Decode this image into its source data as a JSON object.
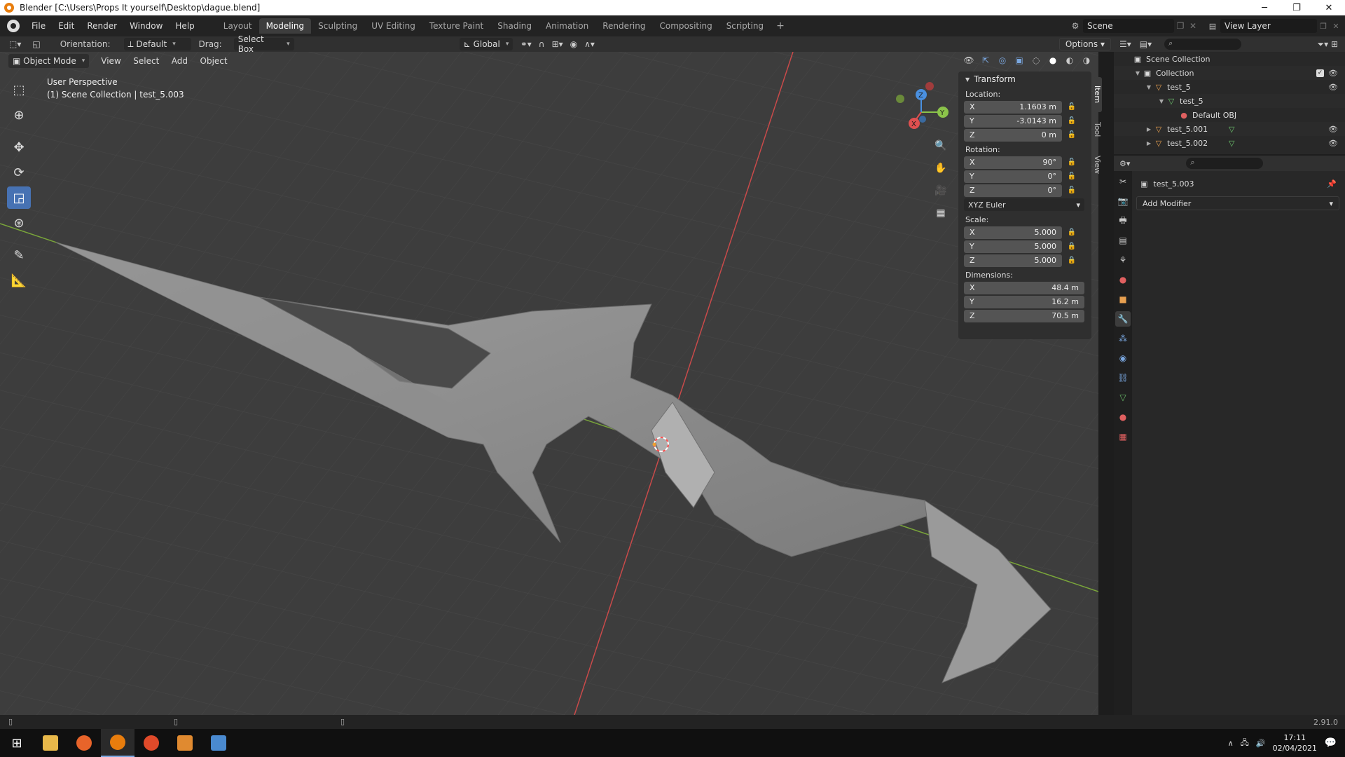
{
  "window": {
    "title": "Blender [C:\\Users\\Props It yourself\\Desktop\\dague.blend]",
    "controls": [
      "─",
      "❐",
      "✕"
    ]
  },
  "topmenu": {
    "items": [
      "File",
      "Edit",
      "Render",
      "Window",
      "Help"
    ],
    "workspaces": [
      "Layout",
      "Modeling",
      "Sculpting",
      "UV Editing",
      "Texture Paint",
      "Shading",
      "Animation",
      "Rendering",
      "Compositing",
      "Scripting"
    ],
    "active_workspace": "Modeling",
    "plus": "+",
    "scene": "Scene",
    "view_layer": "View Layer"
  },
  "toolheader": {
    "orientation_label": "Orientation:",
    "orientation_value": "Default",
    "drag_label": "Drag:",
    "drag_value": "Select Box",
    "transform_orientation": "Global",
    "options": "Options"
  },
  "viewport_header": {
    "mode": "Object Mode",
    "menus": [
      "View",
      "Select",
      "Add",
      "Object"
    ]
  },
  "viewport": {
    "perspective": "User Perspective",
    "collection_info": "(1) Scene Collection | test_5.003"
  },
  "gizmo": {
    "x": "X",
    "y": "Y",
    "z": "Z"
  },
  "npanel": {
    "title": "Transform",
    "location_label": "Location:",
    "location": [
      {
        "axis": "X",
        "value": "1.1603 m"
      },
      {
        "axis": "Y",
        "value": "-3.0143 m"
      },
      {
        "axis": "Z",
        "value": "0 m"
      }
    ],
    "rotation_label": "Rotation:",
    "rotation": [
      {
        "axis": "X",
        "value": "90°"
      },
      {
        "axis": "Y",
        "value": "0°"
      },
      {
        "axis": "Z",
        "value": "0°"
      }
    ],
    "rotation_mode": "XYZ Euler",
    "scale_label": "Scale:",
    "scale": [
      {
        "axis": "X",
        "value": "5.000"
      },
      {
        "axis": "Y",
        "value": "5.000"
      },
      {
        "axis": "Z",
        "value": "5.000"
      }
    ],
    "dimensions_label": "Dimensions:",
    "dimensions": [
      {
        "axis": "X",
        "value": "48.4 m"
      },
      {
        "axis": "Y",
        "value": "16.2 m"
      },
      {
        "axis": "Z",
        "value": "70.5 m"
      }
    ],
    "tabs": [
      "Item",
      "Tool",
      "View"
    ]
  },
  "outliner": {
    "rows": [
      {
        "label": "Scene Collection"
      },
      {
        "label": "Collection"
      },
      {
        "label": "test_5"
      },
      {
        "label": "test_5"
      },
      {
        "label": "Default OBJ"
      },
      {
        "label": "test_5.001"
      },
      {
        "label": "test_5.002"
      }
    ]
  },
  "properties": {
    "object_name": "test_5.003",
    "add_modifier": "Add Modifier"
  },
  "statusbar": {
    "version": "2.91.0"
  },
  "taskbar": {
    "time": "17:11",
    "date": "02/04/2021"
  },
  "colors": {
    "accent": "#4772b3",
    "x_axis": "#e05050",
    "y_axis": "#8bc34a",
    "z_axis": "#4a90e0",
    "blender_orange": "#e87d0d"
  }
}
